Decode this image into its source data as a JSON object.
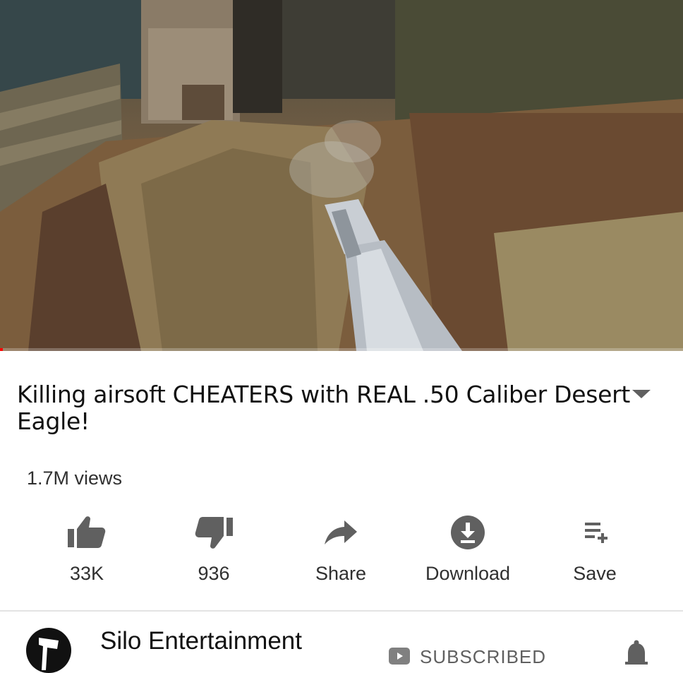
{
  "video": {
    "progress_fraction": 0.004
  },
  "title": "Killing airsoft CHEATERS with REAL .50 Caliber Desert Eagle!",
  "views": "1.7M views",
  "actions": [
    {
      "name": "like",
      "label": "33K",
      "icon": "thumbs-up-icon"
    },
    {
      "name": "dislike",
      "label": "936",
      "icon": "thumbs-down-icon"
    },
    {
      "name": "share",
      "label": "Share",
      "icon": "share-arrow-icon"
    },
    {
      "name": "download",
      "label": "Download",
      "icon": "download-icon"
    },
    {
      "name": "save",
      "label": "Save",
      "icon": "add-to-playlist-icon"
    }
  ],
  "channel": {
    "name": "Silo Entertainment",
    "subscribe_label": "SUBSCRIBED"
  },
  "colors": {
    "progress": "#ff0000",
    "icon_gray": "#606060"
  }
}
